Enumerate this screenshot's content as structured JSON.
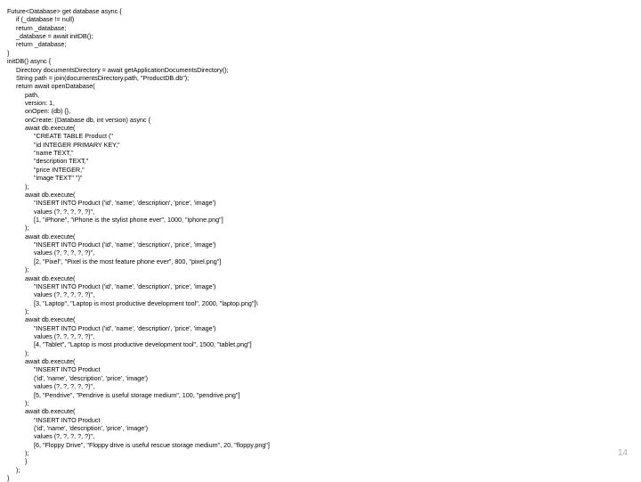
{
  "lines": [
    {
      "indent": 0,
      "text": "Future<Database> get database async {"
    },
    {
      "indent": 1,
      "text": "if (_database != null)"
    },
    {
      "indent": 1,
      "text": "return _database;"
    },
    {
      "indent": 1,
      "text": "_database = await initDB();"
    },
    {
      "indent": 1,
      "text": "return _database;"
    },
    {
      "indent": 0,
      "text": "}"
    },
    {
      "indent": 0,
      "text": "initDB() async {"
    },
    {
      "indent": 1,
      "text": "Directory documentsDirectory = await getApplicationDocumentsDirectory();"
    },
    {
      "indent": 1,
      "text": "String path = join(documentsDirectory.path, \"ProductDB.db\");"
    },
    {
      "indent": 1,
      "text": "return await openDatabase("
    },
    {
      "indent": 2,
      "text": "path,"
    },
    {
      "indent": 2,
      "text": "version: 1,"
    },
    {
      "indent": 2,
      "text": "onOpen: (db) {},"
    },
    {
      "indent": 2,
      "text": "onCreate: (Database db, int version) async {"
    },
    {
      "indent": 2,
      "text": "await db.execute("
    },
    {
      "indent": 3,
      "text": "\"CREATE TABLE Product (\""
    },
    {
      "indent": 3,
      "text": "\"id INTEGER PRIMARY KEY,\""
    },
    {
      "indent": 3,
      "text": "\"name TEXT,\""
    },
    {
      "indent": 3,
      "text": "\"description TEXT,\""
    },
    {
      "indent": 3,
      "text": "\"price INTEGER,\""
    },
    {
      "indent": 3,
      "text": "\"image TEXT\" \")\""
    },
    {
      "indent": 2,
      "text": ");"
    },
    {
      "indent": 2,
      "text": "await db.execute("
    },
    {
      "indent": 3,
      "text": "\"INSERT INTO Product ('id', 'name', 'description', 'price', 'image')"
    },
    {
      "indent": 3,
      "text": "values (?, ?, ?, ?, ?)\","
    },
    {
      "indent": 3,
      "text": "[1, \"iPhone\", \"iPhone is the stylist phone ever\", 1000, \"iphone.png\"]"
    },
    {
      "indent": 2,
      "text": ");"
    },
    {
      "indent": 2,
      "text": "await db.execute("
    },
    {
      "indent": 3,
      "text": "\"INSERT INTO Product ('id', 'name', 'description', 'price', 'image')"
    },
    {
      "indent": 3,
      "text": "values (?, ?, ?, ?, ?)\","
    },
    {
      "indent": 3,
      "text": "[2, \"Pixel\", \"Pixel is the most feature phone ever\", 800, \"pixel.png\"]"
    },
    {
      "indent": 2,
      "text": ");"
    },
    {
      "indent": 2,
      "text": "await db.execute("
    },
    {
      "indent": 3,
      "text": "\"INSERT INTO Product ('id', 'name', 'description', 'price', 'image')"
    },
    {
      "indent": 3,
      "text": "values (?, ?, ?, ?, ?)\","
    },
    {
      "indent": 3,
      "text": "[3, \"Laptop\", \"Laptop is most productive development tool\", 2000, \"laptop.png\"]\\"
    },
    {
      "indent": 2,
      "text": ");"
    },
    {
      "indent": 2,
      "text": "await db.execute("
    },
    {
      "indent": 3,
      "text": "\"INSERT INTO Product ('id', 'name', 'description', 'price', 'image')"
    },
    {
      "indent": 3,
      "text": "values (?, ?, ?, ?, ?)\","
    },
    {
      "indent": 3,
      "text": "[4, \"Tablet\", \"Laptop is most productive development tool\", 1500, \"tablet.png\"]"
    },
    {
      "indent": 2,
      "text": ");"
    },
    {
      "indent": 2,
      "text": "await db.execute("
    },
    {
      "indent": 3,
      "text": "\"INSERT INTO Product"
    },
    {
      "indent": 3,
      "text": "('id', 'name', 'description', 'price', 'image')"
    },
    {
      "indent": 3,
      "text": "values (?, ?, ?, ?, ?)\","
    },
    {
      "indent": 3,
      "text": "[5, \"Pendrive\", \"Pendrive is useful storage medium\", 100, \"pendrive.png\"]"
    },
    {
      "indent": 2,
      "text": ");"
    },
    {
      "indent": 2,
      "text": "await db.execute("
    },
    {
      "indent": 3,
      "text": "\"INSERT INTO Product"
    },
    {
      "indent": 3,
      "text": "('id', 'name', 'description', 'price', 'image')"
    },
    {
      "indent": 3,
      "text": "values (?, ?, ?, ?, ?)\","
    },
    {
      "indent": 3,
      "text": "[6, \"Floppy Drive\", \"Floppy drive is useful rescue storage medium\", 20, \"floppy.png\"]"
    },
    {
      "indent": 2,
      "text": ");"
    },
    {
      "indent": 2,
      "text": "}"
    },
    {
      "indent": 1,
      "text": ");"
    },
    {
      "indent": 0,
      "text": "}"
    }
  ],
  "page_number": "14"
}
